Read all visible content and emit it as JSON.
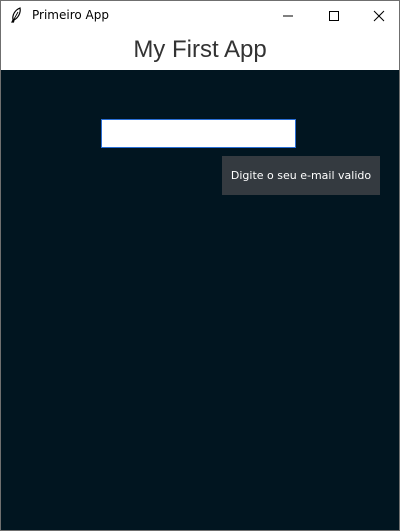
{
  "window": {
    "title": "Primeiro App",
    "icons": {
      "app": "feather-icon",
      "minimize": "minimize-icon",
      "maximize": "maximize-icon",
      "close": "close-icon"
    }
  },
  "header": {
    "title": "My First App"
  },
  "form": {
    "email_value": "",
    "tooltip": "Digite o seu e-mail valido"
  },
  "colors": {
    "content_background": "#011520",
    "tooltip_background": "#343a40",
    "input_border": "#2b6fd6",
    "header_text": "#333333"
  }
}
